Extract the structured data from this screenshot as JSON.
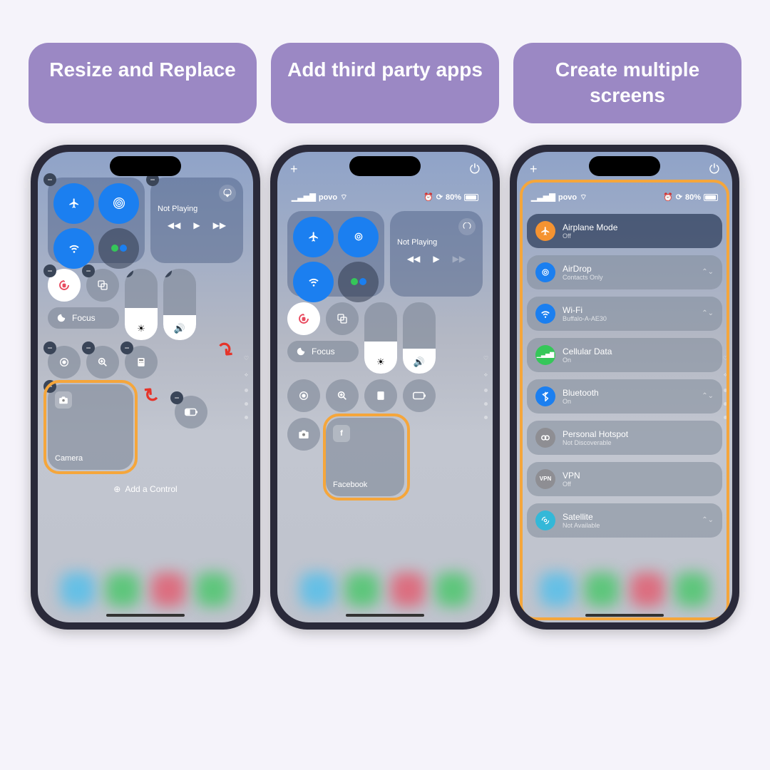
{
  "headers": [
    "Resize and Replace",
    "Add third party apps",
    "Create multiple screens"
  ],
  "carrier": "povo",
  "battery": "80%",
  "media": {
    "nowplaying": "Not Playing"
  },
  "focus": "Focus",
  "camera": "Camera",
  "facebook": "Facebook",
  "add_control": "Add a Control",
  "settings": [
    {
      "title": "Airplane Mode",
      "sub": "Off",
      "color": "#f59331",
      "chev": ""
    },
    {
      "title": "AirDrop",
      "sub": "Contacts Only",
      "color": "#1b7ff0",
      "chev": "⌃⌄"
    },
    {
      "title": "Wi-Fi",
      "sub": "Buffalo-A-AE30",
      "color": "#1b7ff0",
      "chev": "⌃⌄"
    },
    {
      "title": "Cellular Data",
      "sub": "On",
      "color": "#35c759",
      "chev": ""
    },
    {
      "title": "Bluetooth",
      "sub": "On",
      "color": "#1b7ff0",
      "chev": "⌃⌄"
    },
    {
      "title": "Personal Hotspot",
      "sub": "Not Discoverable",
      "color": "#8e8e93",
      "chev": ""
    },
    {
      "title": "VPN",
      "sub": "Off",
      "color": "#8e8e93",
      "chev": ""
    },
    {
      "title": "Satellite",
      "sub": "Not Available",
      "color": "#34b8d8",
      "chev": "⌃⌄"
    }
  ]
}
